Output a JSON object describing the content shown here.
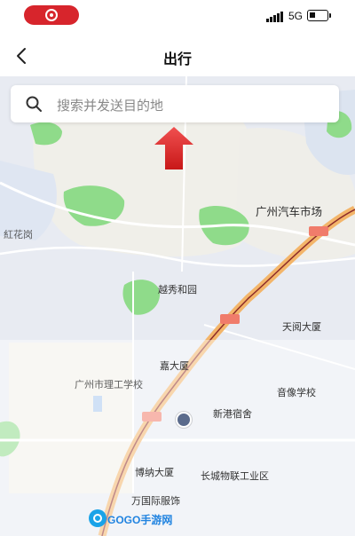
{
  "status_bar": {
    "network": "5G"
  },
  "nav": {
    "title": "出行"
  },
  "search": {
    "placeholder": "搜索并发送目的地"
  },
  "map": {
    "poi": {
      "auto_market": "广州汽车市场",
      "park": "越秀和园",
      "building_tianlan": "天阅大厦",
      "building_jiangsu": "嘉大厦",
      "school": "广州市理工学校",
      "middle_school": "音像学校",
      "peripheral_food": "新港宿舍",
      "bowu_building": "博纳大厦",
      "gallery": "长城物联工业区",
      "shopping": "万国际服饰",
      "label_left": "紅花岗"
    }
  },
  "watermark": {
    "text": "GOGO手游网"
  },
  "colors": {
    "accent_red": "#d7252c",
    "search_bg": "#ffffff",
    "map_green": "#8fdb8a",
    "road_orange": "#f3b56a"
  }
}
